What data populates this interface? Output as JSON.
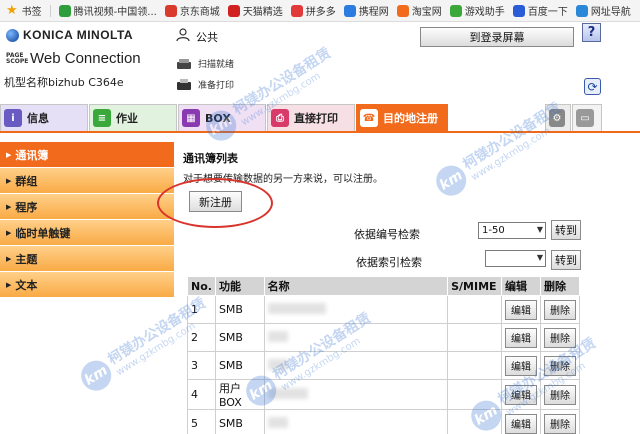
{
  "bookmarks": [
    {
      "label": "书签",
      "color": "#f0a000"
    },
    {
      "label": "腾讯视频-中国领...",
      "color": "#2f9d3b"
    },
    {
      "label": "京东商城",
      "color": "#d93a2b"
    },
    {
      "label": "天猫精选",
      "color": "#d02020"
    },
    {
      "label": "拼多多",
      "color": "#e23a3a"
    },
    {
      "label": "携程网",
      "color": "#2b7be0"
    },
    {
      "label": "淘宝网",
      "color": "#f26b1d"
    },
    {
      "label": "游戏助手",
      "color": "#3aa83a"
    },
    {
      "label": "百度一下",
      "color": "#2a5cd8"
    },
    {
      "label": "网址导航",
      "color": "#2b88d8"
    }
  ],
  "header": {
    "brand": "KONICA MINOLTA",
    "product_small": "PAGE SCOPE",
    "product": "Web Connection",
    "model": "机型名称bizhub C364e",
    "user": "公共",
    "login_button": "到登录屏幕",
    "help_button": "?",
    "scan_label": "扫描就绪",
    "print_label": "准备打印",
    "refresh_button": "⟳"
  },
  "tabs": [
    {
      "label": "信息",
      "icon": "info-icon",
      "color": "#6a5bc2"
    },
    {
      "label": "作业",
      "icon": "job-icon",
      "color": "#3aa83a"
    },
    {
      "label": "BOX",
      "icon": "box-icon",
      "color": "#8a3ab0"
    },
    {
      "label": "直接打印",
      "icon": "print-icon",
      "color": "#d83a6a"
    },
    {
      "label": "目的地注册",
      "icon": "destination-icon",
      "color": "#f26b1d",
      "active": true
    },
    {
      "label": "",
      "icon": "settings-icon",
      "color": "#888888"
    },
    {
      "label": "",
      "icon": "screen-icon",
      "color": "#999999"
    }
  ],
  "sidebar": {
    "items": [
      {
        "label": "通讯簿",
        "active": true
      },
      {
        "label": "群组",
        "active": false
      },
      {
        "label": "程序",
        "active": false
      },
      {
        "label": "临时单触键",
        "active": false
      },
      {
        "label": "主题",
        "active": false
      },
      {
        "label": "文本",
        "active": false
      }
    ]
  },
  "main": {
    "title": "通讯簿列表",
    "description": "对于想要传输数据的另一方来说，可以注册。",
    "new_button": "新注册",
    "search_number_label": "依据编号检索",
    "search_number_value": "1-50",
    "search_index_label": "依据索引检索",
    "search_index_value": "",
    "go_button": "转到"
  },
  "table": {
    "headers": [
      "No.",
      "功能",
      "名称",
      "S/MIME",
      "编辑",
      "删除"
    ],
    "edit_label": "编辑",
    "delete_label": "删除",
    "rows": [
      {
        "no": "1",
        "func": "SMB"
      },
      {
        "no": "2",
        "func": "SMB"
      },
      {
        "no": "3",
        "func": "SMB"
      },
      {
        "no": "4",
        "func": "用户BOX"
      },
      {
        "no": "5",
        "func": "SMB"
      }
    ]
  },
  "watermark": {
    "logo": "km",
    "line1": "柯镁办公设备租赁",
    "line2": "www.gzkmbg.com"
  }
}
